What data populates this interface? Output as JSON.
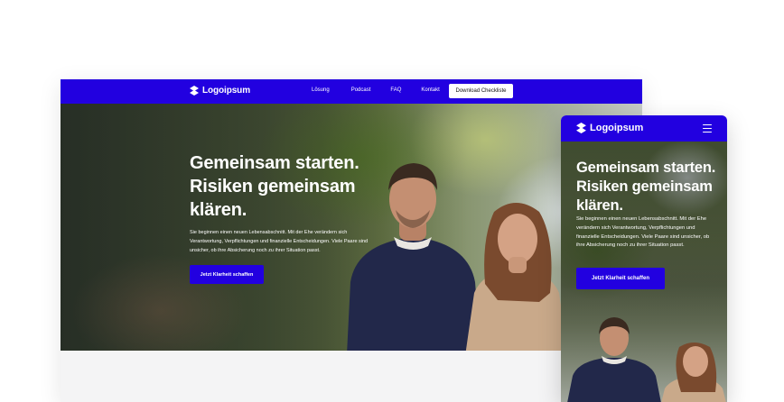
{
  "colors": {
    "brand_blue": "#2200e0",
    "white": "#ffffff",
    "page_bg": "#ffffff",
    "section_bg": "#f4f4f5"
  },
  "desktop": {
    "nav": {
      "logo_icon": "logoipsum-mark-icon",
      "logo_text": "Logoipsum",
      "links": [
        "Lösung",
        "Podcast",
        "FAQ",
        "Kontakt"
      ],
      "cta_label": "Download Checkliste"
    },
    "hero": {
      "title": "Gemeinsam starten. Risiken gemeinsam klären.",
      "body": "Sie beginnen einen neuen Lebensabschnitt. Mit der Ehe verändern sich Verantwortung, Verpflichtungen und finanzielle Entscheidungen. Viele Paare sind unsicher, ob ihre Absicherung noch zu ihrer Situation passt.",
      "button_label": "Jetzt Klarheit schaffen"
    }
  },
  "mobile": {
    "nav": {
      "logo_icon": "logoipsum-mark-icon",
      "logo_text": "Logoipsum",
      "menu_icon": "hamburger-menu-icon"
    },
    "hero": {
      "title": "Gemeinsam starten. Risiken gemeinsam klären.",
      "body": "Sie beginnen einen neuen Lebensabschnitt. Mit der Ehe verändern sich Verantwortung, Verpflichtungen und finanzielle Entscheidungen. Viele Paare sind unsicher, ob ihre Absicherung noch zu ihrer Situation passt.",
      "button_label": "Jetzt Klarheit schaffen"
    }
  }
}
